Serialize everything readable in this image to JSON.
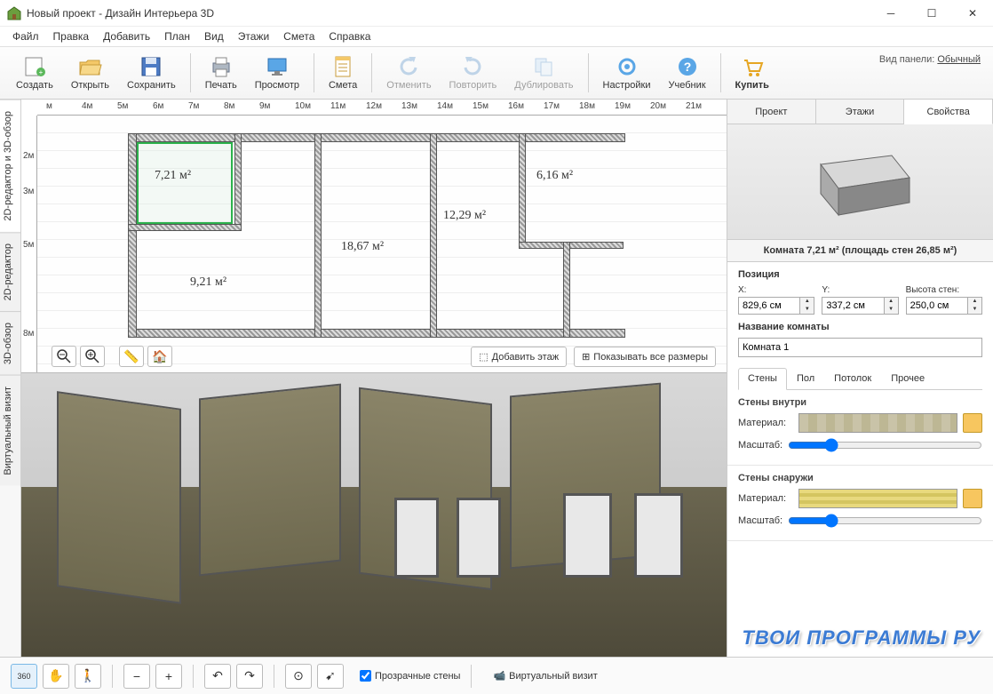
{
  "window": {
    "title": "Новый проект - Дизайн Интерьера 3D"
  },
  "menu": [
    "Файл",
    "Правка",
    "Добавить",
    "План",
    "Вид",
    "Этажи",
    "Смета",
    "Справка"
  ],
  "toolbar": {
    "create": "Создать",
    "open": "Открыть",
    "save": "Сохранить",
    "print": "Печать",
    "preview": "Просмотр",
    "estimate": "Смета",
    "undo": "Отменить",
    "redo": "Повторить",
    "duplicate": "Дублировать",
    "settings": "Настройки",
    "textbook": "Учебник",
    "buy": "Купить",
    "panel_label": "Вид панели:",
    "panel_mode": "Обычный"
  },
  "left_tabs": {
    "t1": "2D-редактор и 3D-обзор",
    "t2": "2D-редактор",
    "t3": "3D-обзор",
    "t4": "Виртуальный визит"
  },
  "ruler_h": [
    "м",
    "4м",
    "5м",
    "6м",
    "7м",
    "8м",
    "9м",
    "10м",
    "11м",
    "12м",
    "13м",
    "14м",
    "15м",
    "16м",
    "17м",
    "18м",
    "19м",
    "20м",
    "21м"
  ],
  "ruler_v": [
    "2м",
    "3м",
    "5м",
    "8м"
  ],
  "rooms": {
    "r1": "7,21 м²",
    "r2": "6,16 м²",
    "r3": "18,67 м²",
    "r4": "12,29 м²",
    "r5": "9,21 м²"
  },
  "plan_buttons": {
    "add_floor": "Добавить этаж",
    "show_dims": "Показывать все размеры"
  },
  "side": {
    "tabs": {
      "project": "Проект",
      "floors": "Этажи",
      "props": "Свойства"
    },
    "room_info": "Комната 7,21 м²  (площадь стен 26,85 м²)",
    "position": "Позиция",
    "pos_x_label": "X:",
    "pos_y_label": "Y:",
    "pos_h_label": "Высота стен:",
    "pos_x": "829,6 см",
    "pos_y": "337,2 см",
    "pos_h": "250,0 см",
    "room_name_label": "Название комнаты",
    "room_name": "Комната 1",
    "subtabs": {
      "walls": "Стены",
      "floor": "Пол",
      "ceil": "Потолок",
      "other": "Прочее"
    },
    "walls_in": "Стены внутри",
    "walls_out": "Стены снаружи",
    "material": "Материал:",
    "scale": "Масштаб:"
  },
  "bottom": {
    "transparent": "Прозрачные стены",
    "virtual": "Виртуальный визит"
  },
  "watermark": "ТВОИ ПРОГРАММЫ РУ"
}
